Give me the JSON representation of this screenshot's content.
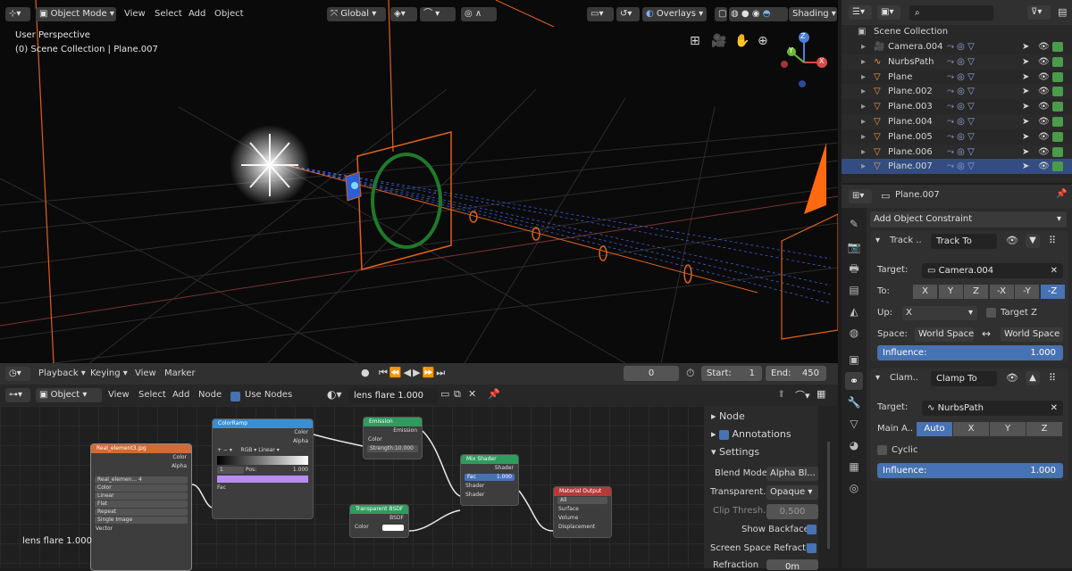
{
  "viewport": {
    "mode": "Object Mode",
    "menus": [
      "View",
      "Select",
      "Add",
      "Object"
    ],
    "orientation": "Global",
    "overlays": "Overlays",
    "shading": "Shading",
    "info_line1": "User Perspective",
    "info_line2": "(0) Scene Collection | Plane.007",
    "gizmo_x": "X",
    "gizmo_y": "Y",
    "gizmo_z": "Z"
  },
  "timeline": {
    "menus": [
      "Playback",
      "Keying",
      "View",
      "Marker"
    ],
    "current_frame": "0",
    "start_label": "Start:",
    "start": "1",
    "end_label": "End:",
    "end": "450"
  },
  "node_editor": {
    "object": "Object",
    "menus": [
      "View",
      "Select",
      "Add",
      "Node"
    ],
    "use_nodes": "Use Nodes",
    "material": "lens flare 1.000",
    "corner_label": "lens flare 1.000",
    "nodes": {
      "image": {
        "title": "Real_element3.jpg",
        "out1": "Color",
        "out2": "Alpha",
        "file": "Real_elemen...",
        "num": "4",
        "opts": [
          "Color",
          "Linear",
          "Flat",
          "Repeat",
          "Single Image"
        ],
        "in": "Vector"
      },
      "ramp": {
        "title": "ColorRamp",
        "out1": "Color",
        "out2": "Alpha",
        "mode": "RGB",
        "interp": "Linear",
        "idx": "1",
        "pos": "Pos:",
        "posval": "1.000",
        "in": "Fac"
      },
      "emission": {
        "title": "Emission",
        "out": "Emission",
        "in1": "Color",
        "in2": "Strength:10.000"
      },
      "transparent": {
        "title": "Transparent BSDF",
        "out": "BSDF",
        "in": "Color"
      },
      "mix": {
        "title": "Mix Shader",
        "out": "Shader",
        "fac": "Fac",
        "facval": "1.000",
        "in1": "Shader",
        "in2": "Shader"
      },
      "output": {
        "title": "Material Output",
        "target": "All",
        "in1": "Surface",
        "in2": "Volume",
        "in3": "Displacement"
      }
    },
    "side": {
      "node": "Node",
      "annotations": "Annotations",
      "settings": "Settings",
      "blend_mode_label": "Blend Mode",
      "blend_mode": "Alpha Bl...",
      "transparent_label": "Transparent...",
      "transparent": "Opaque",
      "clip_label": "Clip Thresh...",
      "clip": "0.500",
      "backface": "Show Backface",
      "ssr": "Screen Space Refracti...",
      "refraction_label": "Refraction",
      "refraction": "0m"
    }
  },
  "outliner": {
    "root": "Scene Collection",
    "items": [
      "Camera.004",
      "NurbsPath",
      "Plane",
      "Plane.002",
      "Plane.003",
      "Plane.004",
      "Plane.005",
      "Plane.006",
      "Plane.007"
    ],
    "selected": "Plane.007"
  },
  "properties": {
    "object": "Plane.007",
    "add_constraint": "Add Object Constraint",
    "c1": {
      "short": "Track ..",
      "name": "Track To",
      "target_label": "Target:",
      "target": "Camera.004",
      "to_label": "To:",
      "axes": [
        "X",
        "Y",
        "Z",
        "-X",
        "-Y",
        "-Z"
      ],
      "up_label": "Up:",
      "up": "X",
      "target_z": "Target Z",
      "space_label": "Space:",
      "space1": "World Space",
      "space2": "World Space",
      "influence": "Influence:",
      "influence_val": "1.000"
    },
    "c2": {
      "short": "Clam..",
      "name": "Clamp To",
      "target_label": "Target:",
      "target": "NurbsPath",
      "main_label": "Main A..",
      "axes": [
        "Auto",
        "X",
        "Y",
        "Z"
      ],
      "cyclic": "Cyclic",
      "influence": "Influence:",
      "influence_val": "1.000"
    }
  },
  "colors": {
    "accent": "#4772b3",
    "selection": "#ff8c1a",
    "node_image": "#cf6b35",
    "node_ramp": "#3a8ed1",
    "node_shader": "#2f9b5e",
    "node_output": "#b53a3a"
  }
}
